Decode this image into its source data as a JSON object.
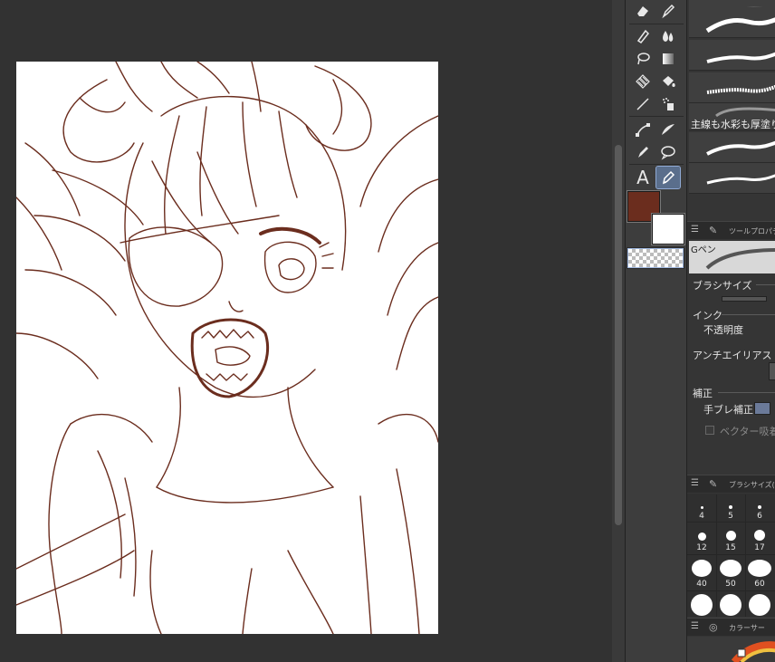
{
  "canvas": {
    "artwork_title": ""
  },
  "toolbar": {
    "tools": [
      {
        "name": "eraser",
        "icon": "eraser-icon"
      },
      {
        "name": "pen",
        "icon": "pen-icon"
      },
      {
        "name": "pencil",
        "icon": "pencil-icon"
      },
      {
        "name": "blend",
        "icon": "blend-icon"
      },
      {
        "name": "lasso",
        "icon": "lasso-icon"
      },
      {
        "name": "gradient",
        "icon": "gradient-icon"
      },
      {
        "name": "fill",
        "icon": "fill-icon"
      },
      {
        "name": "bucket",
        "icon": "bucket-icon"
      },
      {
        "name": "line",
        "icon": "line-icon"
      },
      {
        "name": "airbrush",
        "icon": "airbrush-icon"
      },
      {
        "name": "vector",
        "icon": "vector-icon"
      },
      {
        "name": "decoration",
        "icon": "decoration-icon"
      },
      {
        "name": "correct-line",
        "icon": "correct-line-icon"
      },
      {
        "name": "balloon",
        "icon": "balloon-icon"
      },
      {
        "name": "text",
        "icon": "text-icon",
        "glyph": "A"
      },
      {
        "name": "active-pen",
        "icon": "g-pen-icon"
      }
    ],
    "main_color": "#6b2d1e",
    "sub_color": "#ffffff"
  },
  "sub_tool": {
    "label_main": "主線も水彩も厚塗りも"
  },
  "tool_property": {
    "header": "ツールプロパティ",
    "brush_name": "Gペン",
    "brush_size_label": "ブラシサイズ",
    "ink_label": "インク",
    "opacity_label": "不透明度",
    "antialias_label": "アンチエイリアス",
    "correction_label": "補正",
    "stabilization_label": "手ブレ補正",
    "vector_snap_label": "ベクター吸着"
  },
  "brush_size_panel": {
    "header": "ブラシサイズ(C",
    "sizes": [
      "4",
      "5",
      "6",
      "12",
      "15",
      "17",
      "40",
      "50",
      "60"
    ]
  },
  "color_panel": {
    "header": "カラーサー"
  }
}
